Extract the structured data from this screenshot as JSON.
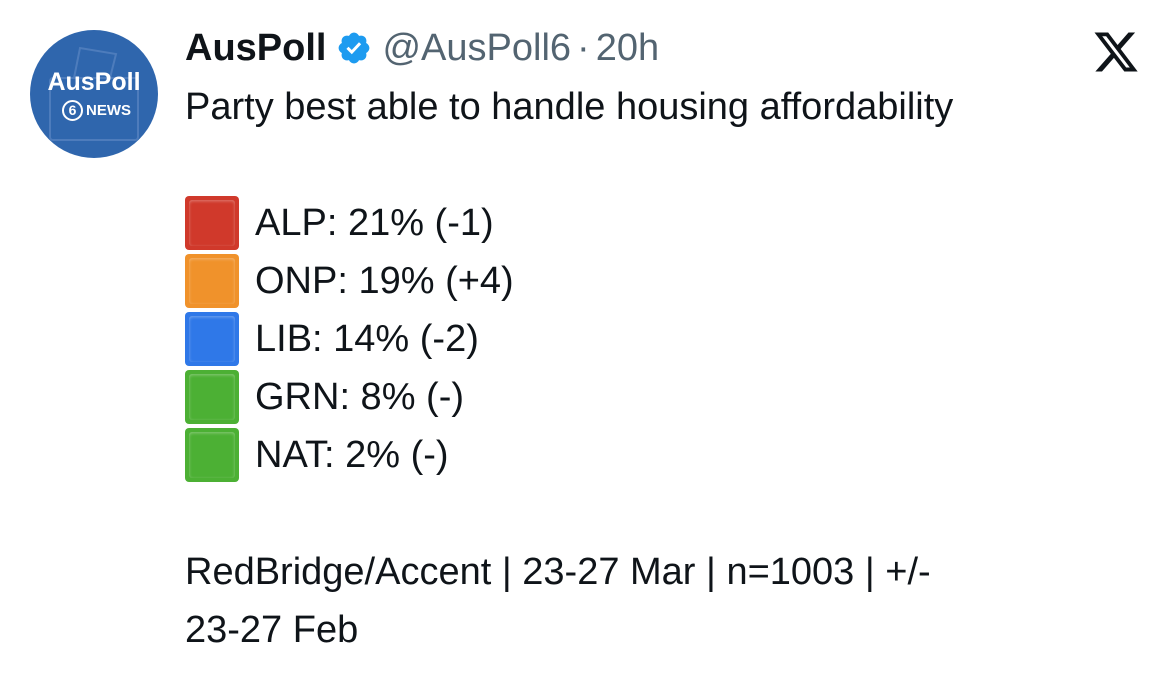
{
  "author": {
    "avatar_title": "AusPoll",
    "avatar_badge_number": "6",
    "avatar_badge_text": "NEWS",
    "name": "AusPoll",
    "handle": "@AusPoll6",
    "separator": "·",
    "time": "20h",
    "verified_icon": "verified-badge-icon",
    "verified_color": "#1d9bf0"
  },
  "platform_icon": "x-logo-icon",
  "tweet": {
    "headline": "Party best able to handle housing affordability",
    "results": [
      {
        "text": "ALP: 21% (-1)",
        "color": "#d0392b"
      },
      {
        "text": "ONP: 19% (+4)",
        "color": "#f0922b"
      },
      {
        "text": "LIB: 14% (-2)",
        "color": "#2f78e8"
      },
      {
        "text": "GRN: 8% (-)",
        "color": "#4cb034"
      },
      {
        "text": "NAT: 2% (-)",
        "color": "#4cb034"
      }
    ],
    "footer_line1": "RedBridge/Accent | 23-27 Mar | n=1003 | +/-",
    "footer_line2": "23-27 Feb"
  },
  "colors": {
    "avatar_bg": "#2f66ad",
    "text": "#0f1419",
    "secondary_text": "#536471"
  }
}
